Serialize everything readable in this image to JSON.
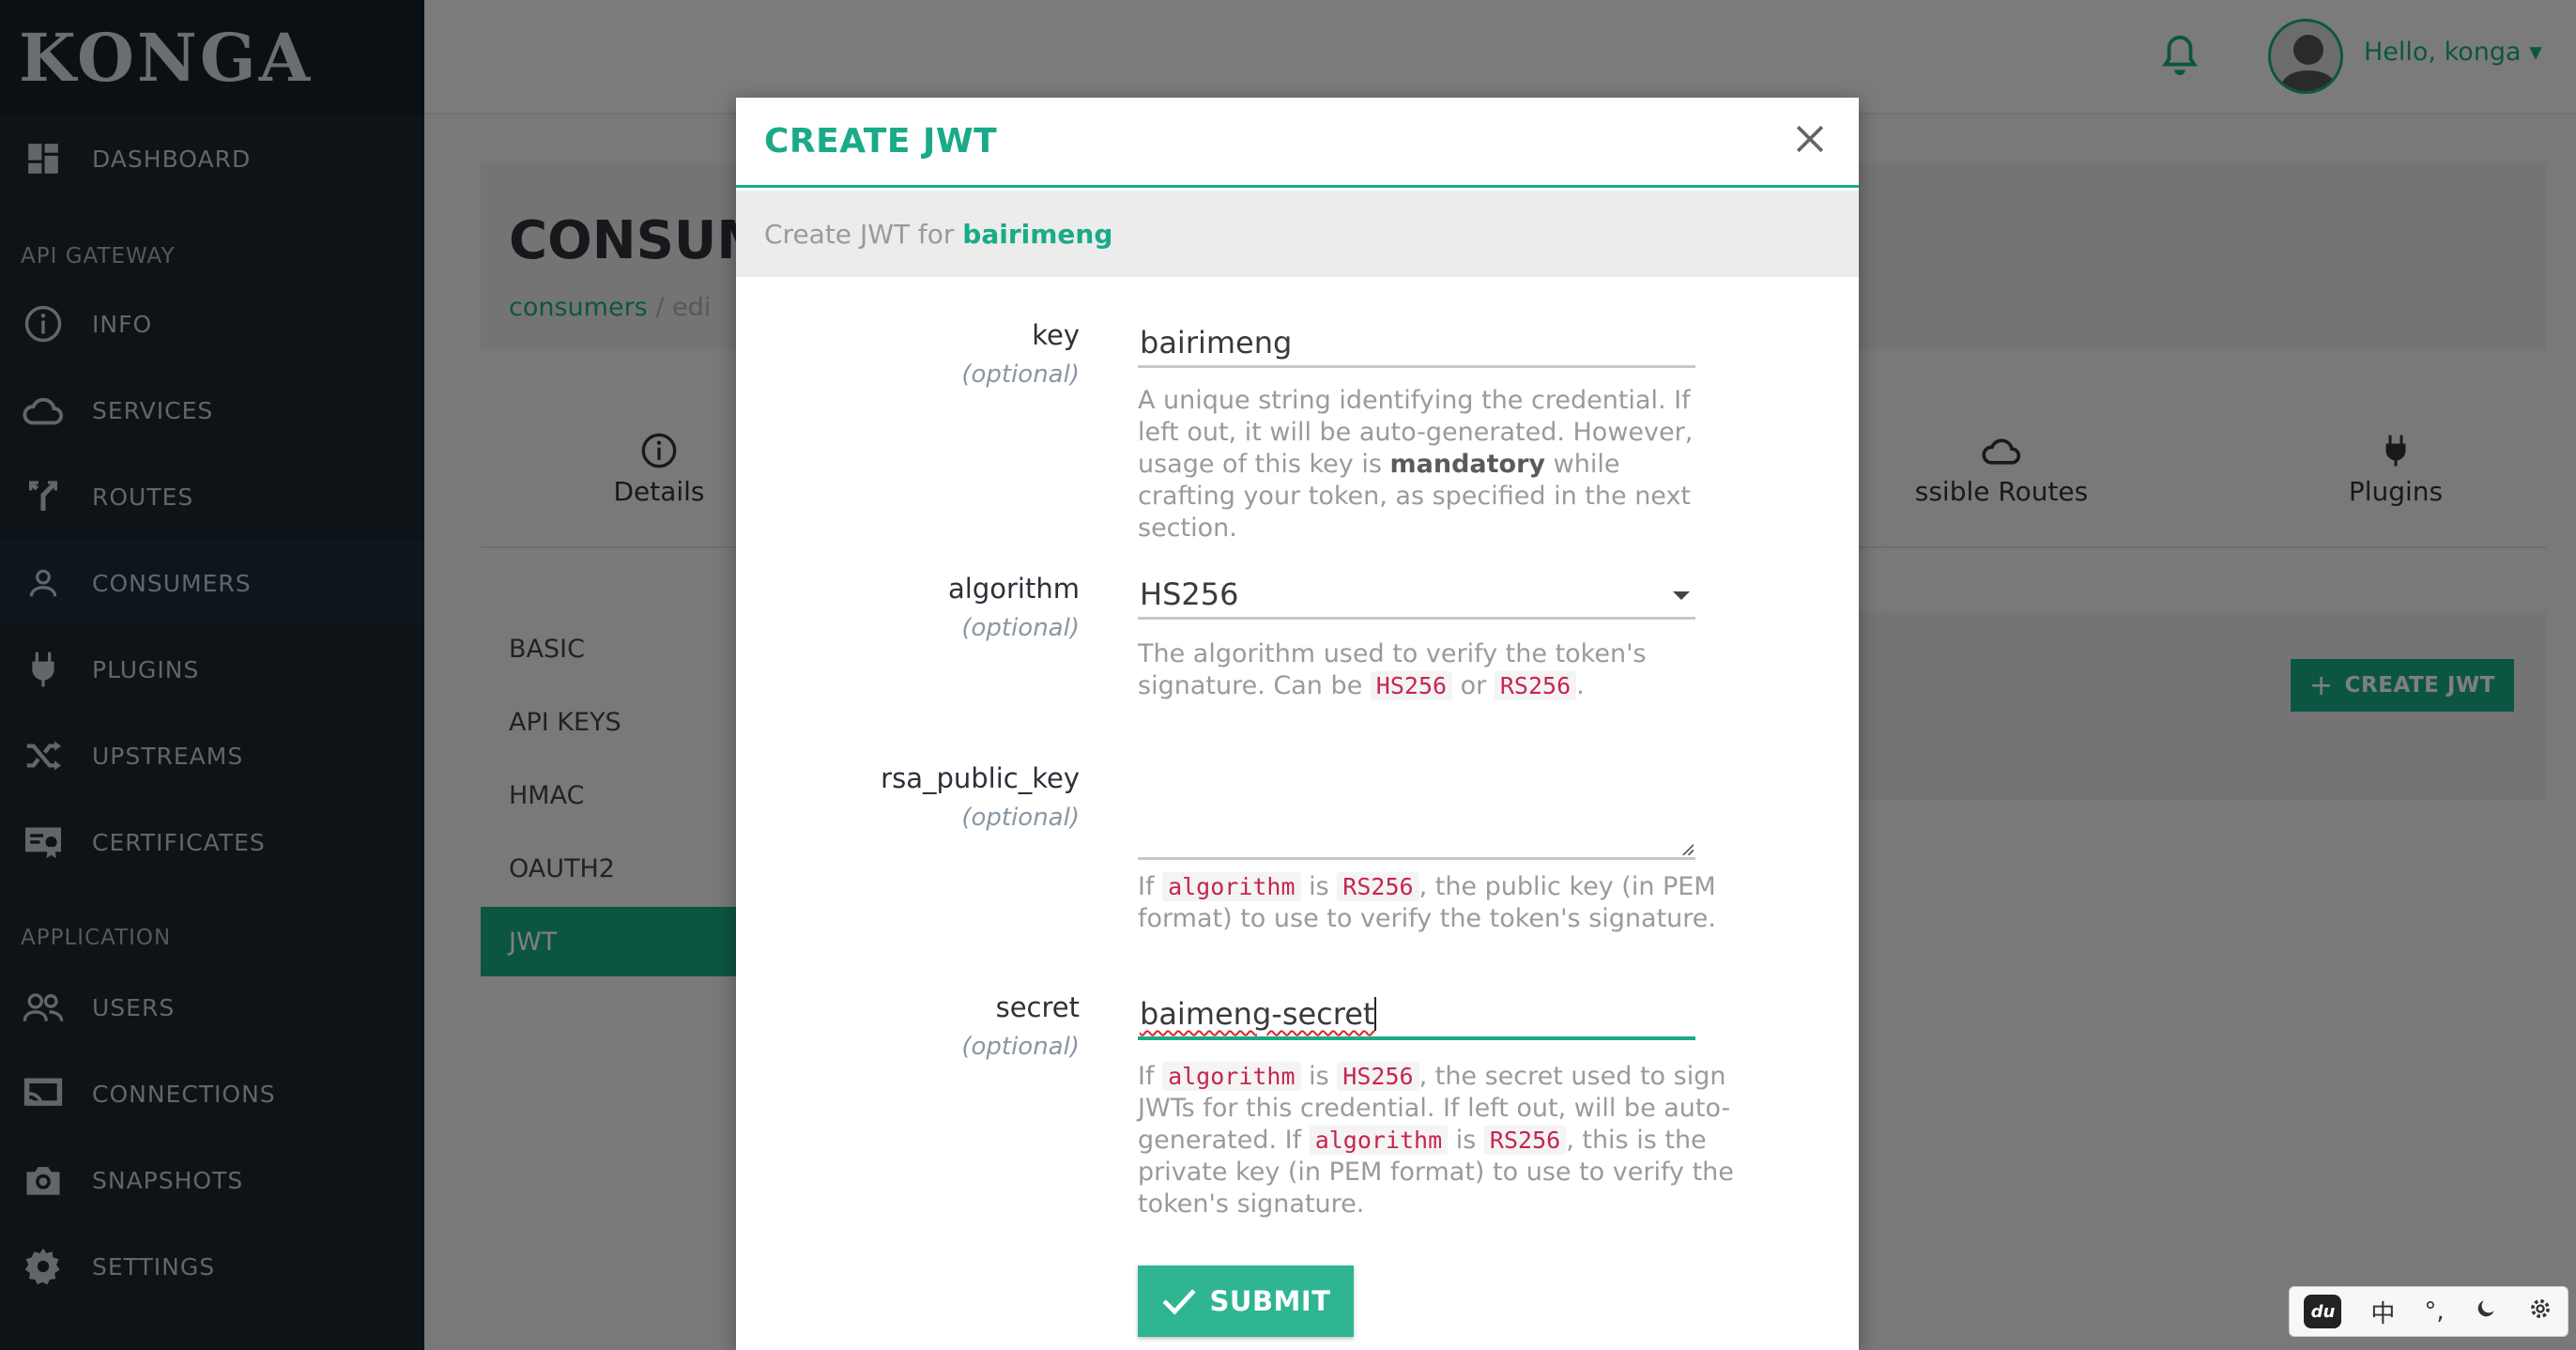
{
  "brand": "KONGA",
  "sidebar": {
    "items": [
      {
        "label": "DASHBOARD",
        "icon": "dashboard-icon"
      },
      {
        "label": "INFO",
        "icon": "info-icon"
      },
      {
        "label": "SERVICES",
        "icon": "cloud-icon"
      },
      {
        "label": "ROUTES",
        "icon": "routes-icon"
      },
      {
        "label": "CONSUMERS",
        "icon": "user-icon"
      },
      {
        "label": "PLUGINS",
        "icon": "plug-icon"
      },
      {
        "label": "UPSTREAMS",
        "icon": "shuffle-icon"
      },
      {
        "label": "CERTIFICATES",
        "icon": "certificate-icon"
      },
      {
        "label": "USERS",
        "icon": "users-icon"
      },
      {
        "label": "CONNECTIONS",
        "icon": "cast-icon"
      },
      {
        "label": "SNAPSHOTS",
        "icon": "camera-icon"
      },
      {
        "label": "SETTINGS",
        "icon": "gear-icon"
      }
    ],
    "sections": {
      "api_gateway": "API GATEWAY",
      "application": "APPLICATION"
    }
  },
  "topbar": {
    "greeting": "Hello, konga"
  },
  "page": {
    "title": "CONSUM",
    "breadcrumb": {
      "root": "consumers",
      "current": "edi"
    },
    "tabs": {
      "details": "Details",
      "routes": "ssible Routes",
      "plugins": "Plugins"
    },
    "subnav": [
      "BASIC",
      "API KEYS",
      "HMAC",
      "OAUTH2",
      "JWT"
    ],
    "create_button": "CREATE JWT"
  },
  "modal": {
    "title": "CREATE JWT",
    "subtitle_prefix": "Create JWT for",
    "consumer_name": "bairimeng",
    "fields": {
      "key": {
        "label": "key",
        "optional": "(optional)",
        "value": "bairimeng"
      },
      "algorithm": {
        "label": "algorithm",
        "optional": "(optional)",
        "value": "HS256"
      },
      "rsa_public_key": {
        "label": "rsa_public_key",
        "optional": "(optional)",
        "value": ""
      },
      "secret": {
        "label": "secret",
        "optional": "(optional)",
        "value": "baimeng-secret"
      }
    },
    "help": {
      "key_1": "A unique string identifying the credential. If left out, it will be auto-generated. However, usage of this key is",
      "key_bold": "mandatory",
      "key_2": "while crafting your token, as specified in the next section.",
      "alg_1": "The algorithm used to verify the token's signature. Can be",
      "alg_or": "or",
      "rsa_if": "If",
      "rsa_is": "is",
      "rsa_rest": ", the public key (in PEM format) to use to verify the token's signature.",
      "sec_if": "If",
      "sec_is": "is",
      "sec_mid": ", the secret used to sign JWTs for this credential. If left out, will be auto-generated. If",
      "sec_is2": "is",
      "sec_rest": ", this is the private key (in PEM format) to use to verify the token's signature."
    },
    "code": {
      "algorithm": "algorithm",
      "hs256": "HS256",
      "rs256": "RS256"
    },
    "submit": "SUBMIT"
  },
  "ime": {
    "lang": "中",
    "punct": "°,",
    "logo": "du"
  }
}
